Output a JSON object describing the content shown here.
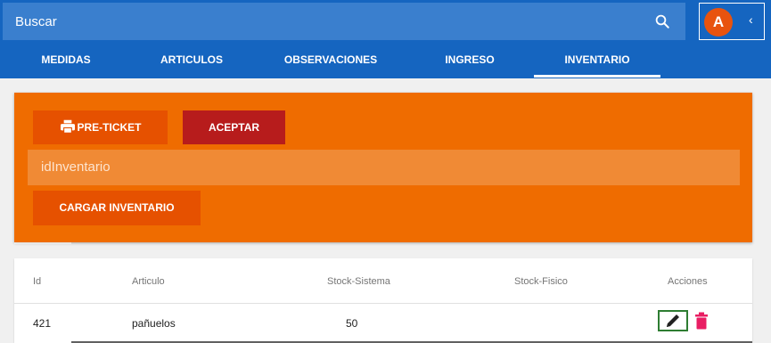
{
  "search": {
    "placeholder": "Buscar",
    "icon": "search-icon"
  },
  "account": {
    "avatar_letter": "A",
    "chevron": "‹",
    "avatar_color": "#e8530e"
  },
  "tabs": [
    {
      "label": "MEDIDAS"
    },
    {
      "label": "ARTICULOS"
    },
    {
      "label": "OBSERVACIONES"
    },
    {
      "label": "INGRESO"
    },
    {
      "label": "INVENTARIO",
      "active": true
    }
  ],
  "form": {
    "preticket_label": "PRE-TICKET",
    "aceptar_label": "ACEPTAR",
    "id_placeholder": "idInventario",
    "cargar_label": "CARGAR INVENTARIO"
  },
  "table": {
    "headers": [
      "Id",
      "Articulo",
      "Stock-Sistema",
      "Stock-Fisico",
      "Acciones"
    ],
    "rows": [
      {
        "id": "421",
        "articulo": "pañuelos",
        "stock_sistema": "50",
        "stock_fisico": ""
      }
    ]
  },
  "colors": {
    "header_blue": "#1565c0",
    "orange_panel": "#ef6c00",
    "aceptar_red": "#b71c1c",
    "delete_pink": "#e91e63",
    "edit_border": "#2e7d32"
  }
}
